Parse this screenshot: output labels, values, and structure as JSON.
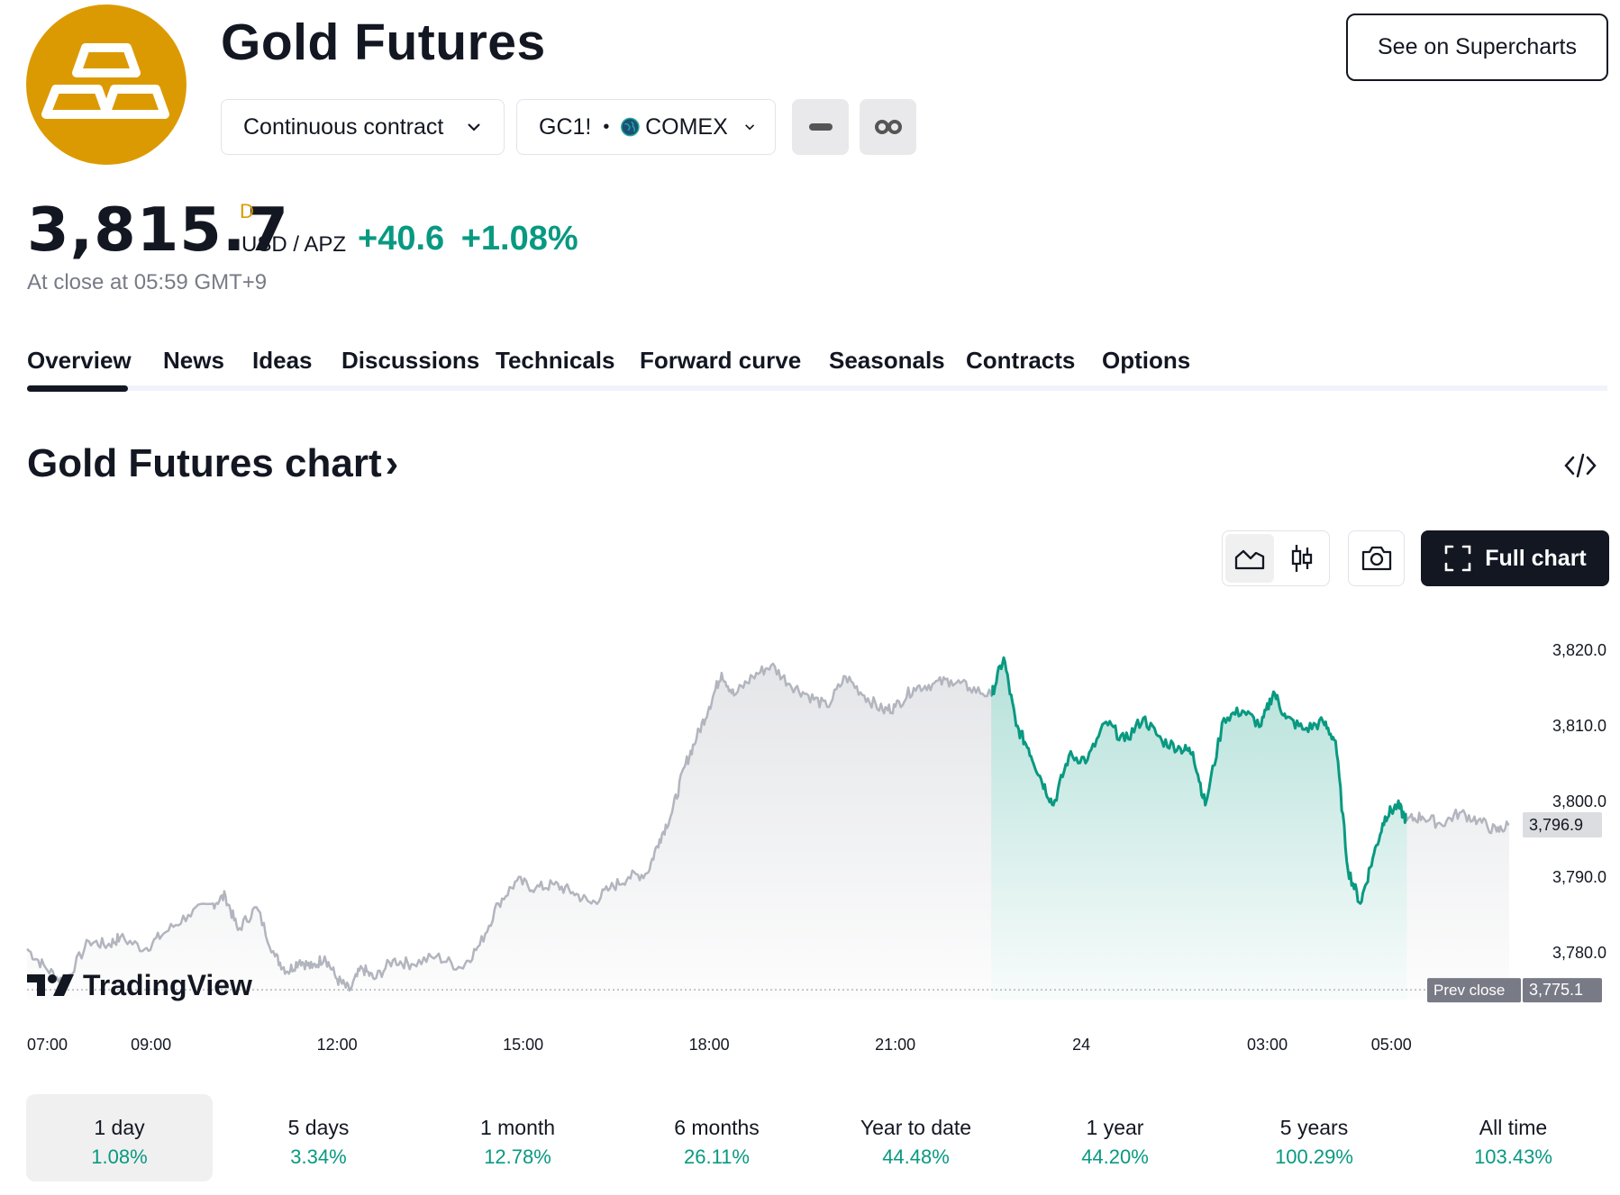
{
  "header": {
    "title": "Gold Futures",
    "contract_select": "Continuous contract",
    "symbol": "GC1!",
    "exchange": "COMEX",
    "supercharts_label": "See on Supercharts",
    "logo_color": "#dc9a02"
  },
  "quote": {
    "price": "3,815.7",
    "flag": "D",
    "currency": "USD / APZ",
    "change": "+40.6",
    "change_pct": "+1.08%",
    "close_time": "At close at 05:59 GMT+9",
    "positive_color": "#089981"
  },
  "tabs": [
    "Overview",
    "News",
    "Ideas",
    "Discussions",
    "Technicals",
    "Forward curve",
    "Seasonals",
    "Contracts",
    "Options"
  ],
  "active_tab": "Overview",
  "chart_section": {
    "title": "Gold Futures chart",
    "title_arrow": "›",
    "full_chart_label": "Full chart",
    "watermark": "TradingView"
  },
  "chart_data": {
    "type": "area",
    "y_ticks": [
      "3,820.0",
      "3,810.0",
      "3,800.0",
      "3,790.0",
      "3,780.0"
    ],
    "y_tick_values": [
      3820,
      3810,
      3800,
      3790,
      3780
    ],
    "ylim": [
      3773.8,
      3823.2
    ],
    "x_ticks": [
      "07:00",
      "09:00",
      "12:00",
      "15:00",
      "18:00",
      "21:00",
      "24",
      "03:00",
      "05:00"
    ],
    "x_tick_hours": [
      7.3,
      9,
      12,
      15,
      18,
      21,
      24,
      27,
      29
    ],
    "x_range_hours": [
      7,
      30.9
    ],
    "last_value_label": "3,796.9",
    "last_value": 3796.9,
    "prev_close_label": "Prev close",
    "prev_close_value_label": "3,775.1",
    "prev_close": 3775.1,
    "session_highlight_hours": [
      22.55,
      29.25
    ],
    "series": [
      {
        "name": "",
        "x": [
          7.0,
          7.3,
          7.6,
          8.0,
          8.3,
          8.5,
          8.9,
          9.2,
          9.6,
          10.0,
          10.2,
          10.4,
          10.7,
          11.0,
          11.2,
          11.4,
          11.6,
          11.8,
          12.0,
          12.2,
          12.4,
          12.6,
          12.9,
          13.2,
          13.6,
          14.0,
          14.3,
          14.6,
          14.9,
          15.2,
          15.5,
          15.8,
          16.1,
          16.4,
          16.7,
          17.0,
          17.2,
          17.4,
          17.6,
          17.8,
          18.0,
          18.2,
          18.4,
          18.7,
          19.0,
          19.3,
          19.6,
          19.9,
          20.2,
          20.5,
          20.8,
          21.0,
          21.3,
          21.6,
          21.9,
          22.2,
          22.55,
          22.75,
          22.95,
          23.15,
          23.35,
          23.55,
          23.8,
          24.1,
          24.4,
          24.7,
          25.0,
          25.3,
          25.6,
          25.8,
          26.0,
          26.3,
          26.6,
          26.9,
          27.1,
          27.3,
          27.6,
          27.9,
          28.1,
          28.3,
          28.5,
          28.7,
          28.9,
          29.1,
          29.25,
          29.5,
          29.8,
          30.1,
          30.4,
          30.7,
          30.9
        ],
        "y": [
          3780.5,
          3778.0,
          3776.0,
          3781.5,
          3781.0,
          3782.0,
          3780.5,
          3782.5,
          3785.0,
          3786.5,
          3787.5,
          3783.0,
          3786.0,
          3779.5,
          3777.5,
          3779.0,
          3778.0,
          3779.5,
          3776.5,
          3775.0,
          3778.0,
          3776.5,
          3779.0,
          3778.5,
          3779.5,
          3778.0,
          3781.0,
          3786.5,
          3789.5,
          3788.5,
          3789.0,
          3788.0,
          3786.5,
          3788.5,
          3790.0,
          3790.5,
          3795.0,
          3798.5,
          3804.5,
          3808.5,
          3812.5,
          3817.0,
          3814.0,
          3816.5,
          3818.0,
          3815.5,
          3814.0,
          3812.5,
          3816.5,
          3814.0,
          3812.0,
          3812.5,
          3815.0,
          3815.5,
          3816.0,
          3815.0,
          3814.0,
          3819.0,
          3810.0,
          3807.0,
          3803.0,
          3799.5,
          3806.0,
          3805.5,
          3810.5,
          3808.0,
          3811.0,
          3808.0,
          3807.0,
          3806.5,
          3799.5,
          3811.0,
          3812.0,
          3810.0,
          3814.5,
          3811.0,
          3809.5,
          3810.5,
          3808.0,
          3791.0,
          3786.5,
          3792.5,
          3798.0,
          3799.5,
          3797.5,
          3798.0,
          3797.0,
          3798.5,
          3797.5,
          3796.0,
          3796.9
        ]
      }
    ],
    "colors": {
      "past": "#b2b5be",
      "session": "#089981"
    }
  },
  "periods": [
    {
      "label": "1 day",
      "value": "1.08%"
    },
    {
      "label": "5 days",
      "value": "3.34%"
    },
    {
      "label": "1 month",
      "value": "12.78%"
    },
    {
      "label": "6 months",
      "value": "26.11%"
    },
    {
      "label": "Year to date",
      "value": "44.48%"
    },
    {
      "label": "1 year",
      "value": "44.20%"
    },
    {
      "label": "5 years",
      "value": "100.29%"
    },
    {
      "label": "All time",
      "value": "103.43%"
    }
  ],
  "icons": {
    "logo": "gold-bars-icon",
    "embed": "code-icon",
    "area": "area-chart-icon",
    "candles": "candles-icon",
    "snapshot": "camera-icon",
    "fullscreen": "fullscreen-icon"
  }
}
